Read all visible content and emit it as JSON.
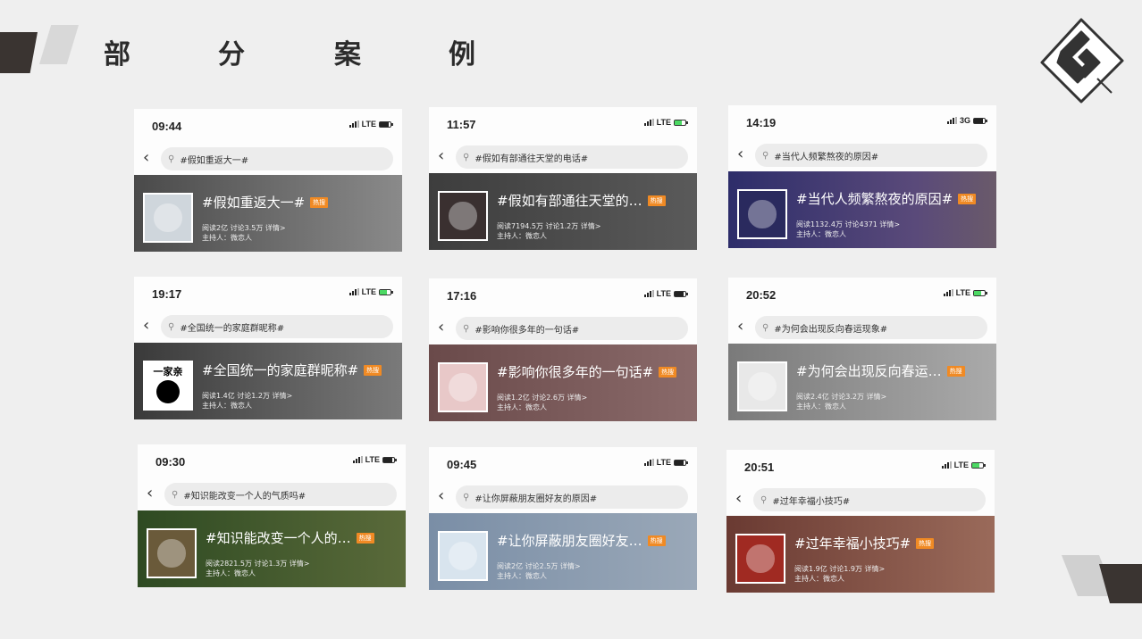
{
  "page": {
    "title_chars": [
      "部",
      "分",
      "案",
      "例"
    ]
  },
  "colors": {
    "background": "#efefef",
    "dark_accent": "#3a3431",
    "hot_badge": "#f08a24"
  },
  "cards": [
    {
      "time": "09:44",
      "network": "LTE",
      "search": "#假如重返大一#",
      "topic": "#假如重返大一#",
      "hot": "热搜",
      "stats": "阅读2亿 讨论3.5万 详情>",
      "host": "主持人：微恋人",
      "battery": "dark"
    },
    {
      "time": "11:57",
      "network": "LTE",
      "search": "#假如有部通往天堂的电话#",
      "topic": "#假如有部通往天堂的…",
      "hot": "热搜",
      "stats": "阅读7194.5万 讨论1.2万 详情>",
      "host": "主持人：微恋人",
      "battery": "green"
    },
    {
      "time": "14:19",
      "network": "3G",
      "search": "#当代人频繁熬夜的原因#",
      "topic": "#当代人频繁熬夜的原因#",
      "hot": "热搜",
      "stats": "阅读1132.4万 讨论4371 详情>",
      "host": "主持人：微恋人",
      "battery": "dark"
    },
    {
      "time": "19:17",
      "network": "LTE",
      "search": "#全国统一的家庭群昵称#",
      "topic": "#全国统一的家庭群昵称#",
      "hot": "热搜",
      "stats": "阅读1.4亿 讨论1.2万 详情>",
      "host": "主持人：微恋人",
      "battery": "green",
      "thumb_text": "一家亲"
    },
    {
      "time": "17:16",
      "network": "LTE",
      "search": "#影响你很多年的一句话#",
      "topic": "#影响你很多年的一句话#",
      "hot": "热搜",
      "stats": "阅读1.2亿 讨论2.6万 详情>",
      "host": "主持人：微恋人",
      "battery": "dark"
    },
    {
      "time": "20:52",
      "network": "LTE",
      "search": "#为何会出现反向春运现象#",
      "topic": "#为何会出现反向春运…",
      "hot": "热搜",
      "stats": "阅读2.4亿 讨论3.2万 详情>",
      "host": "主持人：微恋人",
      "battery": "green"
    },
    {
      "time": "09:30",
      "network": "LTE",
      "search": "#知识能改变一个人的气质吗#",
      "topic": "#知识能改变一个人的…",
      "hot": "热搜",
      "stats": "阅读2821.5万 讨论1.3万 详情>",
      "host": "主持人：微恋人",
      "battery": "dark"
    },
    {
      "time": "09:45",
      "network": "LTE",
      "search": "#让你屏蔽朋友圈好友的原因#",
      "topic": "#让你屏蔽朋友圈好友…",
      "hot": "热搜",
      "stats": "阅读2亿 讨论2.5万 详情>",
      "host": "主持人：微恋人",
      "battery": "dark"
    },
    {
      "time": "20:51",
      "network": "LTE",
      "search": "#过年幸福小技巧#",
      "topic": "#过年幸福小技巧#",
      "hot": "热搜",
      "stats": "阅读1.9亿 讨论1.9万 详情>",
      "host": "主持人：微恋人",
      "battery": "green"
    }
  ]
}
